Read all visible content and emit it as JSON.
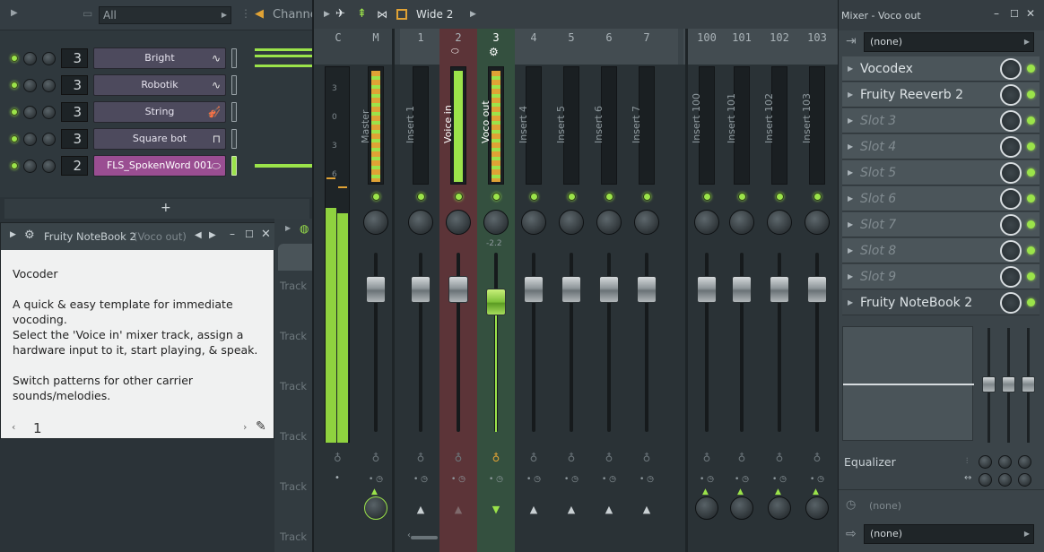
{
  "rack": {
    "filter": "All",
    "title": "Channe",
    "add_label": "+",
    "channels": [
      {
        "num": "3",
        "name": "Bright",
        "icon": "wave",
        "selected": false
      },
      {
        "num": "3",
        "name": "Robotik",
        "icon": "wave",
        "selected": false
      },
      {
        "num": "3",
        "name": "String",
        "icon": "violin",
        "selected": false
      },
      {
        "num": "3",
        "name": "Square bot",
        "icon": "square",
        "selected": false
      },
      {
        "num": "2",
        "name": "FLS_SpokenWord 001",
        "icon": "lips",
        "selected": true
      }
    ]
  },
  "notebook": {
    "title": "Fruity NoteBook 2",
    "subtitle": "(Voco out)",
    "line1": "Vocoder",
    "line2": "A quick & easy template for immediate vocoding.",
    "line3a": "Select the 'Voice in' mixer track, assign a",
    "line3b": "hardware input to it, start playing, & speak.",
    "line4": "Switch patterns for other carrier sounds/melodies.",
    "page": "1"
  },
  "playlist": {
    "track_label": "Track"
  },
  "mixer": {
    "view": "Wide 2",
    "strips": [
      {
        "num": "C",
        "label": ""
      },
      {
        "num": "M",
        "label": "Master"
      },
      {
        "num": "1",
        "label": "Insert 1"
      },
      {
        "num": "2",
        "label": "Voice in"
      },
      {
        "num": "3",
        "label": "Voco out"
      },
      {
        "num": "4",
        "label": "Insert 4"
      },
      {
        "num": "5",
        "label": "Insert 5"
      },
      {
        "num": "6",
        "label": "Insert 6"
      },
      {
        "num": "7",
        "label": "Insert 7"
      },
      {
        "num": "100",
        "label": "Insert 100"
      },
      {
        "num": "101",
        "label": "Insert 101"
      },
      {
        "num": "102",
        "label": "Insert 102"
      },
      {
        "num": "103",
        "label": "Insert 103"
      }
    ],
    "fader_readout": "-2.2",
    "scale": [
      "3",
      "0",
      "3",
      "6"
    ]
  },
  "fx": {
    "title": "Mixer - Voco out",
    "input": "(none)",
    "slots": [
      {
        "name": "Vocodex",
        "empty": false
      },
      {
        "name": "Fruity Reeverb 2",
        "empty": false
      },
      {
        "name": "Slot 3",
        "empty": true
      },
      {
        "name": "Slot 4",
        "empty": true
      },
      {
        "name": "Slot 5",
        "empty": true
      },
      {
        "name": "Slot 6",
        "empty": true
      },
      {
        "name": "Slot 7",
        "empty": true
      },
      {
        "name": "Slot 8",
        "empty": true
      },
      {
        "name": "Slot 9",
        "empty": true
      },
      {
        "name": "Fruity NoteBook 2",
        "empty": false
      }
    ],
    "eq_label": "Equalizer",
    "time_label": "(none)",
    "output": "(none)"
  },
  "colors": {
    "accent": "#9be34a",
    "selected_channel": "#9a4e92",
    "voice_in_strip": "#6b3b3e",
    "voco_out_strip": "#3d5a4a"
  }
}
